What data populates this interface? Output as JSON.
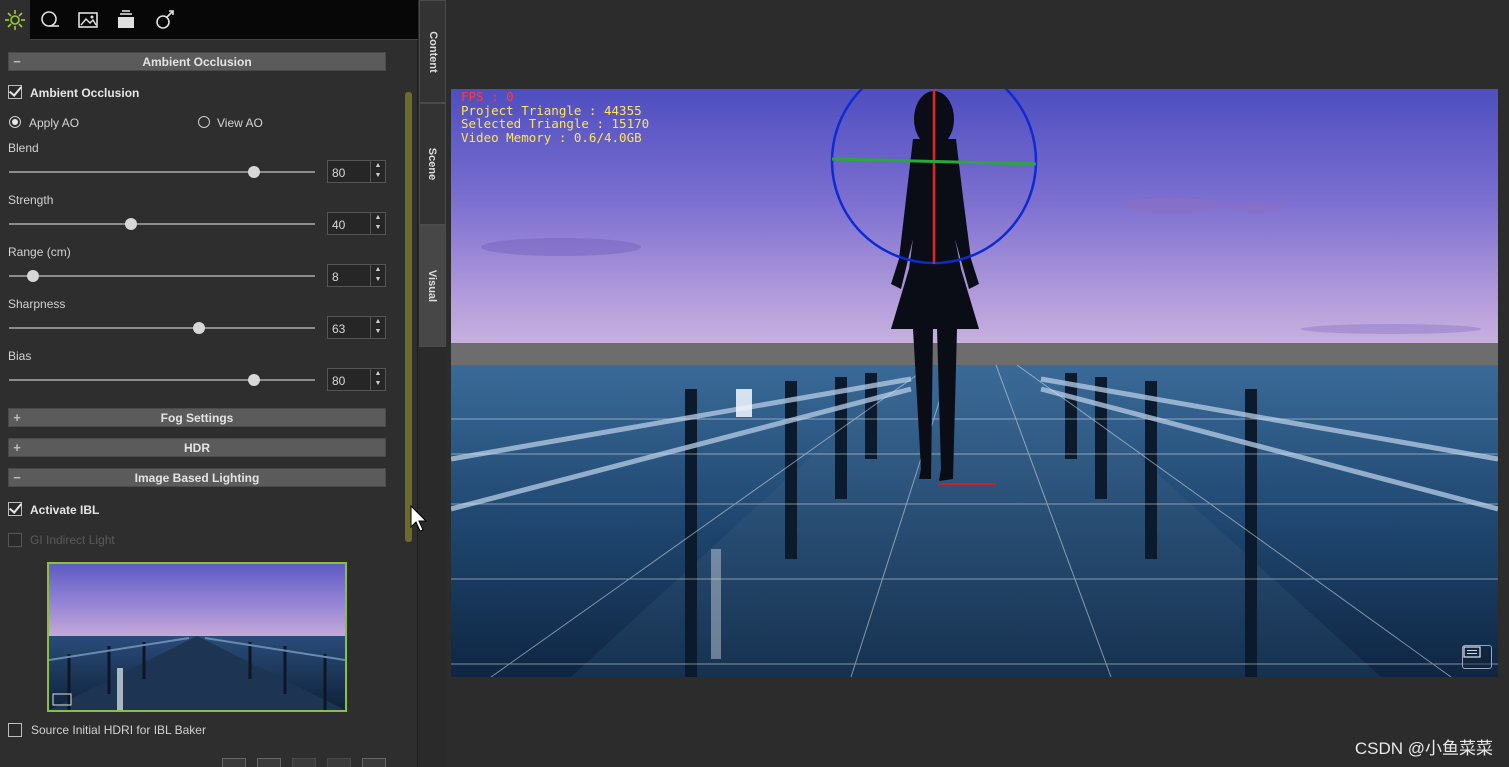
{
  "toolbar": {
    "icons": [
      "effects-icon",
      "sphere-icon",
      "image-icon",
      "layers-icon",
      "settings-edit-icon"
    ]
  },
  "ambient_occlusion": {
    "section_title": "Ambient Occlusion",
    "toggle_sign": "−",
    "enable_label": "Ambient Occlusion",
    "enabled": true,
    "apply_ao_label": "Apply AO",
    "view_ao_label": "View AO",
    "selected_mode": "Apply AO",
    "sliders": [
      {
        "label": "Blend",
        "value": "80",
        "fraction": 0.8
      },
      {
        "label": "Strength",
        "value": "40",
        "fraction": 0.4
      },
      {
        "label": "Range (cm)",
        "value": "8",
        "fraction": 0.08
      },
      {
        "label": "Sharpness",
        "value": "63",
        "fraction": 0.62
      },
      {
        "label": "Bias",
        "value": "80",
        "fraction": 0.8
      }
    ]
  },
  "fog": {
    "section_title": "Fog Settings",
    "toggle_sign": "+"
  },
  "hdr": {
    "section_title": "HDR",
    "toggle_sign": "+"
  },
  "ibl": {
    "section_title": "Image Based Lighting",
    "toggle_sign": "−",
    "activate_label": "Activate IBL",
    "activated": true,
    "gi_label": "GI Indirect Light",
    "gi_enabled": false,
    "source_label": "Source Initial HDRI for IBL Baker",
    "source_checked": false
  },
  "side_tabs": [
    "Content",
    "Scene",
    "Visual"
  ],
  "active_side_tab": "Visual",
  "viewport": {
    "fps": "FPS : 0",
    "project_triangle": "Project Triangle : 44355",
    "selected_triangle": "Selected Triangle : 15170",
    "video_memory": "Video Memory : 0.6/4.0GB"
  },
  "watermark": "CSDN @小鱼菜菜",
  "colors": {
    "accent_green": "#8cbf3a",
    "scrollbar": "#6d6a2c",
    "fps_red": "#ff3b3b",
    "stats_yellow": "#ffe55a"
  }
}
